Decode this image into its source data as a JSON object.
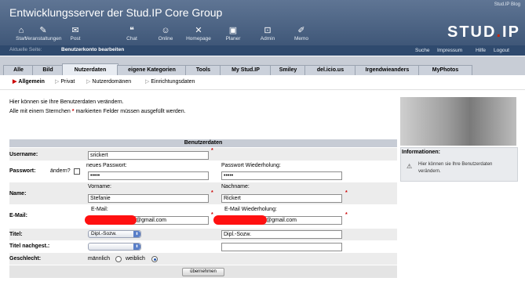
{
  "header": {
    "title": "Entwicklungsserver der Stud.IP Core Group",
    "blog_link": "Stud.IP Blog",
    "logo_main": "STUD",
    "logo_dot": ".",
    "logo_end": "IP",
    "nav": [
      {
        "label": "Start",
        "icon": "home-icon",
        "glyph": "⌂"
      },
      {
        "label": "Veranstaltungen",
        "icon": "courses-icon",
        "glyph": "✎"
      },
      {
        "label": "Post",
        "icon": "mail-icon",
        "glyph": "✉"
      },
      {
        "label": "Chat",
        "icon": "chat-icon",
        "glyph": "❝"
      },
      {
        "label": "Online",
        "icon": "online-icon",
        "glyph": "☺"
      },
      {
        "label": "Homepage",
        "icon": "homepage-icon",
        "glyph": "✕"
      },
      {
        "label": "Planer",
        "icon": "planner-icon",
        "glyph": "▣"
      },
      {
        "label": "Admin",
        "icon": "admin-icon",
        "glyph": "⊡"
      },
      {
        "label": "Memo",
        "icon": "memo-icon",
        "glyph": "✐"
      }
    ]
  },
  "subbar": {
    "current_label": "Aktuelle Seite:",
    "page_title": "Benutzerkonto bearbeiten",
    "links": [
      "Suche",
      "Impressum",
      "Hilfe",
      "Logout"
    ]
  },
  "tabs": [
    "Alle",
    "Bild",
    "Nutzerdaten",
    "eigene Kategorien",
    "Tools",
    "My Stud.IP",
    "Smiley",
    "del.icio.us",
    "Irgendwieanders",
    "MyPhotos"
  ],
  "active_tab": "Nutzerdaten",
  "subnav": [
    "Allgemein",
    "Privat",
    "Nutzerdomänen",
    "Einrichtungsdaten"
  ],
  "intro": {
    "line1": "Hier können sie Ihre Benutzerdaten verändern.",
    "line2a": "Alle mit einem Sternchen",
    "star": "*",
    "line2b": "markierten Felder müssen ausgefüllt werden."
  },
  "sidebar": {
    "title": "Informationen:",
    "text": "Hier können sie Ihre Benutzerdaten verändern."
  },
  "form": {
    "header": "Benutzerdaten",
    "username_label": "Username:",
    "username_value": "srickert",
    "password_label": "Passwort:",
    "change_label": "ändern?",
    "new_password_label": "neues Passwort:",
    "new_password_value": "•••••",
    "repeat_password_label": "Passwort Wiederholung:",
    "repeat_password_value": "•••••",
    "name_label": "Name:",
    "firstname_label": "Vorname:",
    "firstname_value": "Stefanie",
    "lastname_label": "Nachname:",
    "lastname_value": "Rickert",
    "email_label": "E-Mail:",
    "email_sublabel": "E-Mail:",
    "email_value": "@gmail.com",
    "email_repeat_label": "E-Mail Wiederholung:",
    "email_repeat_value": "@gmail.com",
    "title_label": "Titel:",
    "title_select": "Dipl.-Sozw.",
    "title_value": "Dipl.-Sozw.",
    "title_after_label": "Titel nachgest.:",
    "title_after_select": "",
    "title_after_value": "",
    "gender_label": "Geschlecht:",
    "gender_male": "männlich",
    "gender_female": "weiblich",
    "gender_selected": "weiblich",
    "submit": "übernehmen"
  }
}
